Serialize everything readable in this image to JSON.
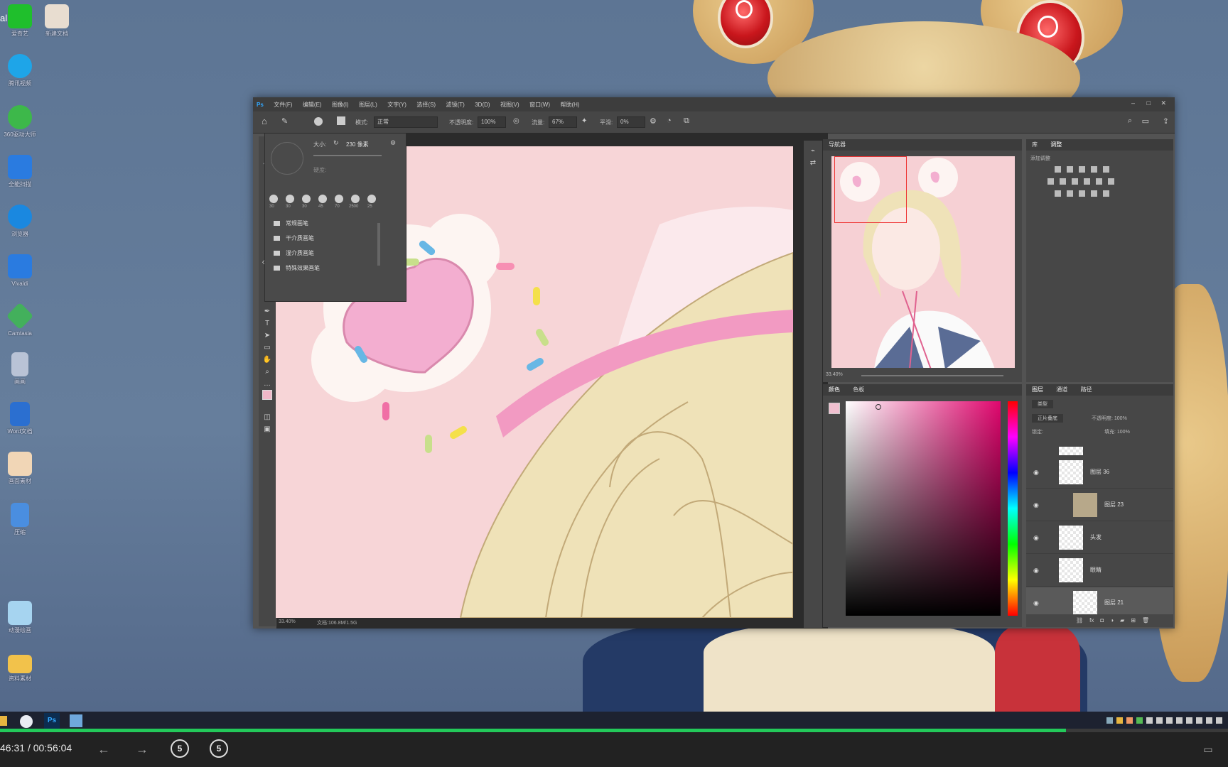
{
  "desktop": {
    "icons": [
      {
        "name": "iqiyi-icon",
        "label": "爱奇艺",
        "color": "#1fbf2c"
      },
      {
        "name": "document-app-icon",
        "label": "新建文档",
        "color": "#e8ddd0"
      },
      {
        "name": "video-player-icon",
        "label": "腾讯视频",
        "color": "#1ea5e8"
      },
      {
        "name": "green-app-icon",
        "label": "360驱动大师",
        "color": "#3db84a"
      },
      {
        "name": "mountain-app-icon",
        "label": "全能扫描",
        "color": "#2a7be0"
      },
      {
        "name": "browser-icon",
        "label": "浏览器",
        "color": "#1a88e0"
      },
      {
        "name": "check-app-icon",
        "label": "Vivaldi",
        "color": "#2a7be0"
      },
      {
        "name": "cube-app-icon",
        "label": "Camtasia",
        "color": "#43b05c"
      },
      {
        "name": "character-file-icon",
        "label": "画画",
        "color": "#b9c3d6"
      },
      {
        "name": "word-doc-icon",
        "label": "Word文档",
        "color": "#2b6fd0"
      },
      {
        "name": "image-file-icon",
        "label": "画面素材",
        "color": "#f1d6b6"
      },
      {
        "name": "zip-file-icon",
        "label": "压缩",
        "color": "#4a8ee0"
      },
      {
        "name": "anime-app-icon",
        "label": "动漫绘画",
        "color": "#a6d4f0"
      },
      {
        "name": "folder-icon",
        "label": "资料素材",
        "color": "#f2c24b"
      }
    ],
    "corner_text": "al"
  },
  "photoshop": {
    "menu": [
      "文件(F)",
      "编辑(E)",
      "图像(I)",
      "图层(L)",
      "文字(Y)",
      "选择(S)",
      "滤镜(T)",
      "3D(D)",
      "视图(V)",
      "窗口(W)",
      "帮助(H)"
    ],
    "options": {
      "mode_label": "模式:",
      "mode_value": "正常",
      "opacity_label": "不透明度:",
      "opacity_value": "100%",
      "flow_label": "流量:",
      "flow_value": "67%",
      "smooth_label": "平滑:",
      "smooth_value": "0%"
    },
    "brush_panel": {
      "size_label": "大小:",
      "size_value": "230 像素",
      "hardness_label": "硬度:",
      "preset_sizes": [
        "30",
        "30",
        "30",
        "45",
        "70",
        "2500",
        "25"
      ],
      "folders": [
        "常规画笔",
        "干介质画笔",
        "湿介质画笔",
        "特殊效果画笔"
      ]
    },
    "navigator_title": "导航器",
    "zoom_nav": "33.40%",
    "adjust_tabs": [
      "库",
      "调整"
    ],
    "adjust_sub": "添加调整",
    "color_tabs": [
      "颜色",
      "色板"
    ],
    "color_accent": "#e0076e",
    "layers_tabs": [
      "图层",
      "通道",
      "路径"
    ],
    "layers_filter": "类型",
    "layers_blend": "正片叠底",
    "layers_opacity": "不透明度: 100%",
    "layers_fill": "填充: 100%",
    "layers_lock": "锁定:",
    "layers": [
      {
        "name": "图层 36"
      },
      {
        "name": "图层 23"
      },
      {
        "name": "头发"
      },
      {
        "name": "眼睛"
      },
      {
        "name": "图层 21"
      }
    ],
    "status_zoom": "33.40%",
    "status_doc": "文档:106.8M/1.5G"
  },
  "player": {
    "time_current": "46:31",
    "time_separator": "/",
    "time_total": "00:56:04",
    "progress": 0.868,
    "skip_back": "5",
    "skip_forward": "5"
  }
}
